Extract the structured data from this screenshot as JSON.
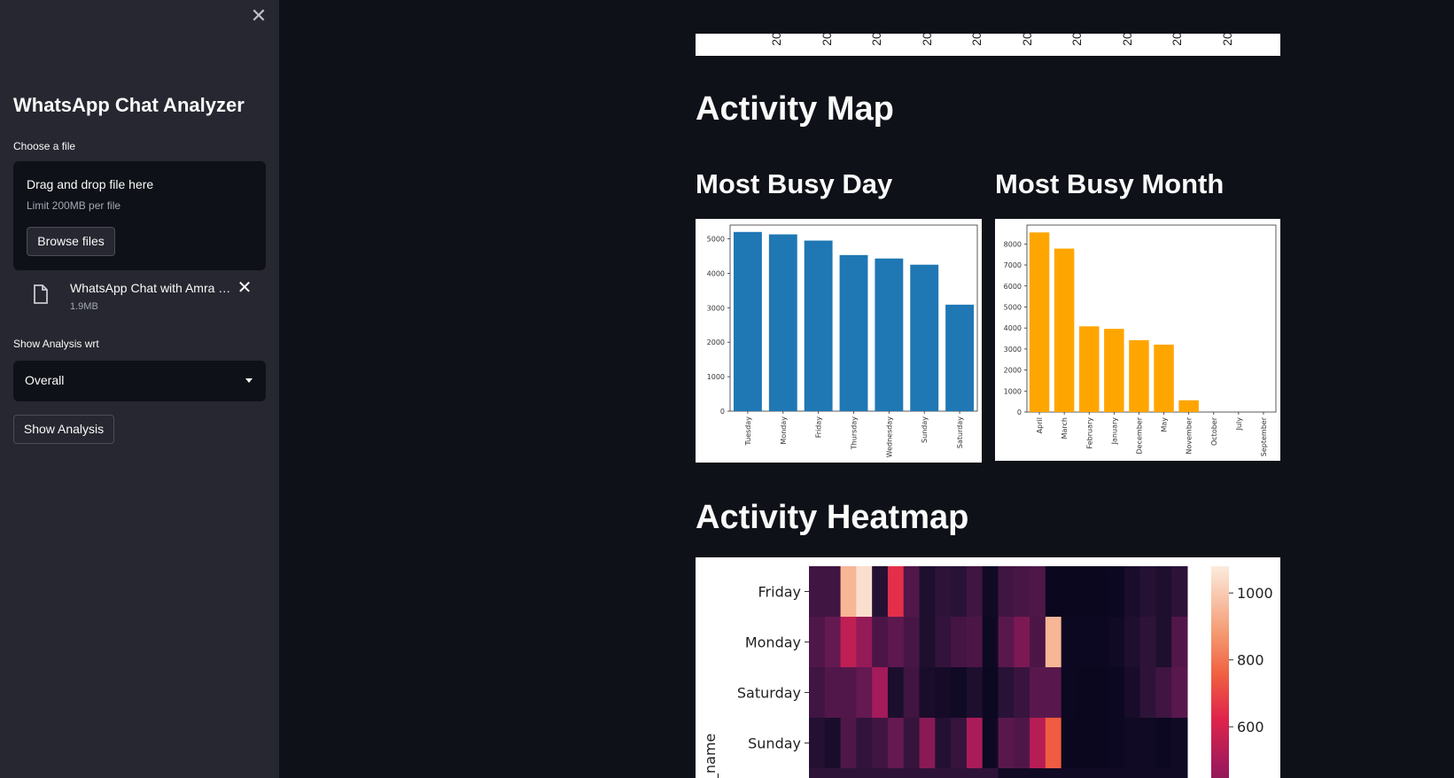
{
  "sidebar": {
    "title": "WhatsApp Chat Analyzer",
    "file_label": "Choose a file",
    "dropzone": {
      "title": "Drag and drop file here",
      "limit": "Limit 200MB per file",
      "browse_label": "Browse files"
    },
    "uploaded_file": {
      "name": "WhatsApp Chat with Amra …",
      "size": "1.9MB"
    },
    "analysis_label": "Show Analysis wrt",
    "analysis_selected": "Overall",
    "show_button": "Show Analysis"
  },
  "main": {
    "strip_ticks": [
      "20",
      "20",
      "20",
      "20",
      "20",
      "20",
      "20",
      "20",
      "20",
      "20"
    ],
    "activity_map_title": "Activity Map",
    "busy_day_title": "Most Busy Day",
    "busy_month_title": "Most Busy Month",
    "heatmap_title": "Activity Heatmap"
  },
  "chart_data": [
    {
      "type": "bar",
      "categories": [
        "Tuesday",
        "Monday",
        "Friday",
        "Thursday",
        "Wednesday",
        "Sunday",
        "Saturday"
      ],
      "values": [
        5200,
        5130,
        4950,
        4530,
        4430,
        4250,
        3090
      ],
      "ylim": [
        0,
        5400
      ],
      "yticks": [
        0,
        1000,
        2000,
        3000,
        4000,
        5000
      ],
      "color": "#1f77b4",
      "title": "",
      "xlabel": "",
      "ylabel": ""
    },
    {
      "type": "bar",
      "categories": [
        "April",
        "March",
        "February",
        "January",
        "December",
        "May",
        "November",
        "October",
        "July",
        "September"
      ],
      "values": [
        8550,
        7780,
        4080,
        3960,
        3420,
        3210,
        560,
        0,
        0,
        0
      ],
      "ylim": [
        0,
        8900
      ],
      "yticks": [
        0,
        1000,
        2000,
        3000,
        4000,
        5000,
        6000,
        7000,
        8000
      ],
      "color": "#ffa500",
      "title": "",
      "xlabel": "",
      "ylabel": ""
    },
    {
      "type": "heatmap",
      "ylabel": "day_name",
      "rows": [
        "Friday",
        "Monday",
        "Saturday",
        "Sunday"
      ],
      "colorbar_ticks": [
        1000,
        800,
        600
      ],
      "values": [
        [
          230,
          230,
          950,
          1050,
          150,
          650,
          280,
          120,
          180,
          160,
          230,
          60,
          230,
          250,
          270,
          30,
          30,
          30,
          30,
          40,
          100,
          150,
          120,
          180
        ],
        [
          270,
          330,
          550,
          450,
          260,
          310,
          250,
          120,
          190,
          240,
          260,
          50,
          300,
          390,
          260,
          950,
          40,
          40,
          40,
          60,
          120,
          180,
          120,
          280
        ],
        [
          230,
          280,
          280,
          330,
          490,
          110,
          230,
          100,
          80,
          60,
          120,
          40,
          160,
          210,
          300,
          300,
          40,
          30,
          30,
          40,
          90,
          180,
          230,
          300
        ],
        [
          140,
          100,
          270,
          190,
          230,
          330,
          200,
          420,
          140,
          200,
          500,
          50,
          300,
          270,
          530,
          750,
          30,
          30,
          30,
          40,
          60,
          60,
          40,
          60
        ]
      ]
    }
  ]
}
